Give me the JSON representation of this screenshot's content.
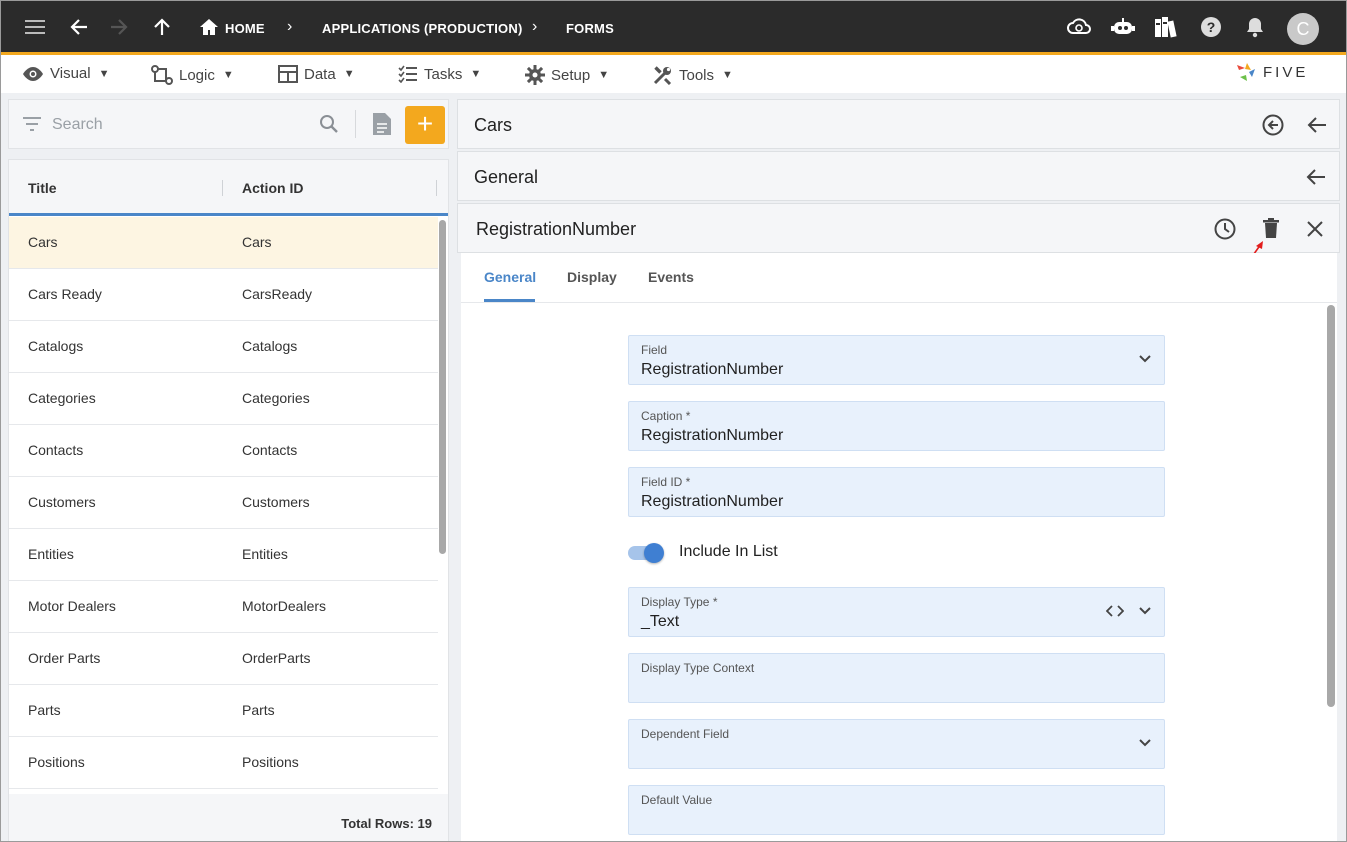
{
  "topbar": {
    "breadcrumb": {
      "home": "HOME",
      "app": "APPLICATIONS (PRODUCTION)",
      "page": "FORMS"
    },
    "avatar_letter": "C",
    "accent": "#f3a81e"
  },
  "menu": {
    "visual": "Visual",
    "logic": "Logic",
    "data": "Data",
    "tasks": "Tasks",
    "setup": "Setup",
    "tools": "Tools"
  },
  "logo_text": "FIVE",
  "search": {
    "placeholder": "Search"
  },
  "list": {
    "columns": [
      "Title",
      "Action ID"
    ],
    "rows": [
      {
        "title": "Cars",
        "action_id": "Cars"
      },
      {
        "title": "Cars Ready",
        "action_id": "CarsReady"
      },
      {
        "title": "Catalogs",
        "action_id": "Catalogs"
      },
      {
        "title": "Categories",
        "action_id": "Categories"
      },
      {
        "title": "Contacts",
        "action_id": "Contacts"
      },
      {
        "title": "Customers",
        "action_id": "Customers"
      },
      {
        "title": "Entities",
        "action_id": "Entities"
      },
      {
        "title": "Motor Dealers",
        "action_id": "MotorDealers"
      },
      {
        "title": "Order Parts",
        "action_id": "OrderParts"
      },
      {
        "title": "Parts",
        "action_id": "Parts"
      },
      {
        "title": "Positions",
        "action_id": "Positions"
      }
    ],
    "total_rows": "Total Rows: 19"
  },
  "panel": {
    "form_title": "Cars",
    "section_title": "General",
    "field_title": "RegistrationNumber",
    "tabs": [
      "General",
      "Display",
      "Events"
    ]
  },
  "form": {
    "field": {
      "label": "Field",
      "value": "RegistrationNumber"
    },
    "caption": {
      "label": "Caption *",
      "value": "RegistrationNumber"
    },
    "field_id": {
      "label": "Field ID *",
      "value": "RegistrationNumber"
    },
    "include_in_list": {
      "label": "Include In List",
      "on": true
    },
    "display_type": {
      "label": "Display Type *",
      "value": "_Text"
    },
    "display_type_context": {
      "label": "Display Type Context",
      "value": ""
    },
    "dependent_field": {
      "label": "Dependent Field",
      "value": ""
    },
    "default_value": {
      "label": "Default Value",
      "value": ""
    }
  }
}
